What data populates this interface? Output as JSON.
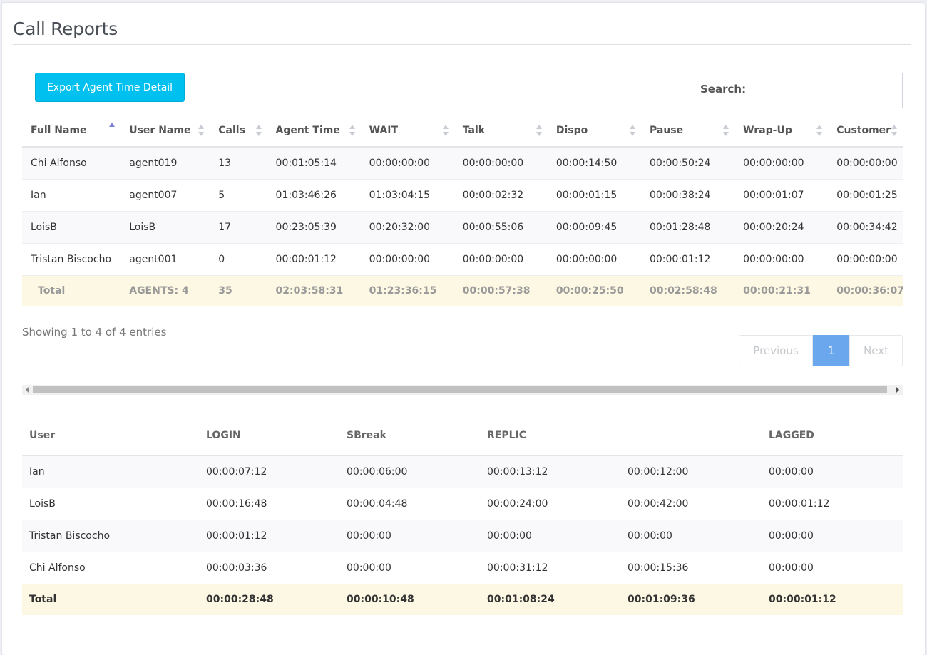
{
  "page": {
    "title": "Call Reports"
  },
  "toolbar": {
    "export_label": "Export Agent Time Detail",
    "search_label": "Search:",
    "search_value": ""
  },
  "agent_table": {
    "columns": [
      "Full Name",
      "User Name",
      "Calls",
      "Agent Time",
      "WAIT",
      "Talk",
      "Dispo",
      "Pause",
      "Wrap-Up",
      "Customer"
    ],
    "rows": [
      [
        "Chi Alfonso",
        "agent019",
        "13",
        "00:01:05:14",
        "00:00:00:00",
        "00:00:00:00",
        "00:00:14:50",
        "00:00:50:24",
        "00:00:00:00",
        "00:00:00:00"
      ],
      [
        "Ian",
        "agent007",
        "5",
        "01:03:46:26",
        "01:03:04:15",
        "00:00:02:32",
        "00:00:01:15",
        "00:00:38:24",
        "00:00:01:07",
        "00:00:01:25"
      ],
      [
        "LoisB",
        "LoisB",
        "17",
        "00:23:05:39",
        "00:20:32:00",
        "00:00:55:06",
        "00:00:09:45",
        "00:01:28:48",
        "00:00:20:24",
        "00:00:34:42"
      ],
      [
        "Tristan Biscocho",
        "agent001",
        "0",
        "00:00:01:12",
        "00:00:00:00",
        "00:00:00:00",
        "00:00:00:00",
        "00:00:01:12",
        "00:00:00:00",
        "00:00:00:00"
      ]
    ],
    "totals": [
      "Total",
      "AGENTS: 4",
      "35",
      "02:03:58:31",
      "01:23:36:15",
      "00:00:57:38",
      "00:00:25:50",
      "00:02:58:48",
      "00:00:21:31",
      "00:00:36:07"
    ],
    "sorted_column": "Full Name",
    "sort_direction": "ascending"
  },
  "info": {
    "showing_text": "Showing 1 to 4 of 4 entries"
  },
  "pagination": {
    "previous_label": "Previous",
    "current_page": "1",
    "next_label": "Next"
  },
  "status_table": {
    "columns": [
      "User",
      "LOGIN",
      "SBreak",
      "REPLIC",
      "",
      "LAGGED"
    ],
    "rows": [
      [
        "Ian",
        "00:00:07:12",
        "00:00:06:00",
        "00:00:13:12",
        "00:00:12:00",
        "00:00:00"
      ],
      [
        "LoisB",
        "00:00:16:48",
        "00:00:04:48",
        "00:00:24:00",
        "00:00:42:00",
        "00:00:01:12"
      ],
      [
        "Tristan Biscocho",
        "00:00:01:12",
        "00:00:00",
        "00:00:00",
        "00:00:00",
        "00:00:00"
      ],
      [
        "Chi Alfonso",
        "00:00:03:36",
        "00:00:00",
        "00:00:31:12",
        "00:00:15:36",
        "00:00:00"
      ]
    ],
    "totals": [
      "Total",
      "00:00:28:48",
      "00:00:10:48",
      "00:01:08:24",
      "00:01:09:36",
      "00:00:01:12"
    ]
  },
  "colors": {
    "accent": "#00c0ef",
    "active_page": "#6aa7ec",
    "total_row": "#fcf8e3"
  }
}
